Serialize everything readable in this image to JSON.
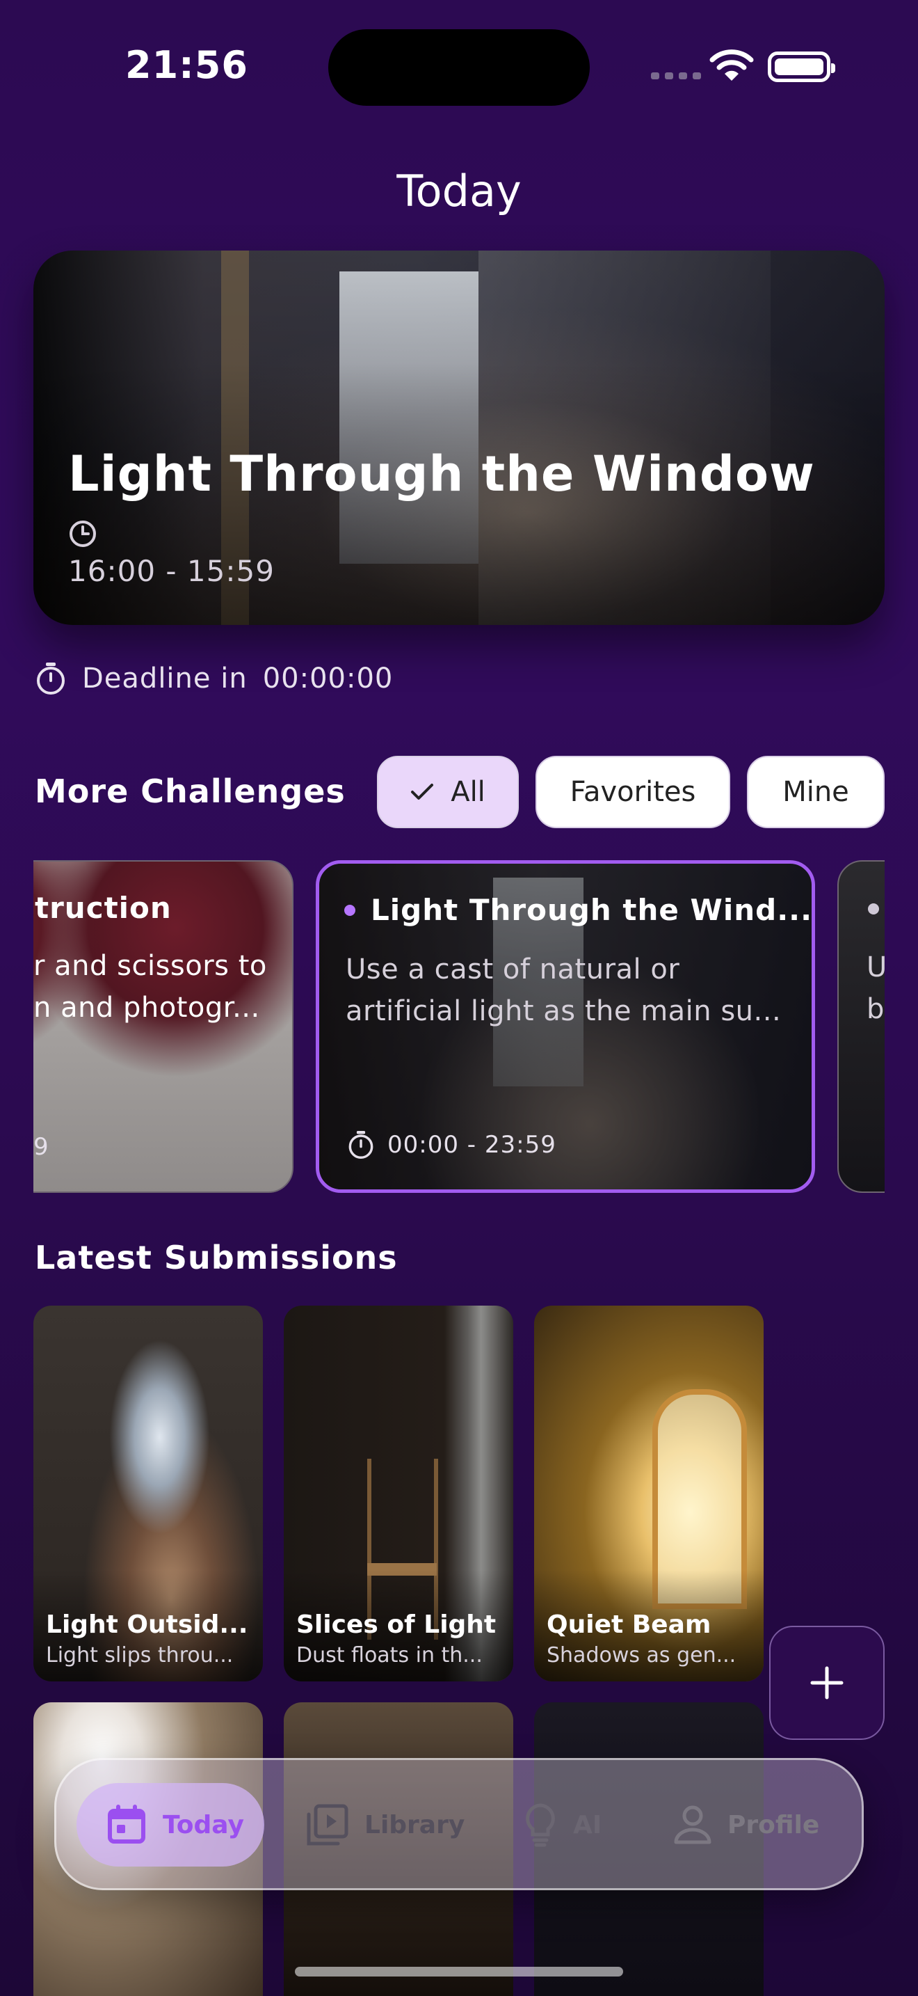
{
  "status_bar": {
    "time": "21:56"
  },
  "header": {
    "title": "Today"
  },
  "hero": {
    "title": "Light Through the Window",
    "time_range": "16:00 - 15:59",
    "clock_icon": "clock-icon"
  },
  "deadline": {
    "label": "Deadline in",
    "countdown": "00:00:00",
    "icon": "stopwatch-icon"
  },
  "more_challenges": {
    "title": "More Challenges",
    "filters": [
      {
        "label": "All",
        "selected": true
      },
      {
        "label": "Favorites",
        "selected": false
      },
      {
        "label": "Mine",
        "selected": false
      }
    ],
    "cards": [
      {
        "title": "truction",
        "desc_lines": [
          "r and scissors to",
          "n and photogr..."
        ],
        "time": "9"
      },
      {
        "title": "Light Through the Wind...",
        "desc_lines": [
          "Use a cast of natural or",
          "artificial light as the main su..."
        ],
        "time": "00:00 - 23:59"
      },
      {
        "title": "",
        "desc_lines": [
          "U",
          "b"
        ],
        "time": ""
      }
    ]
  },
  "latest": {
    "title": "Latest Submissions",
    "items": [
      {
        "title": "Light Outsid...",
        "desc": "Light slips throu..."
      },
      {
        "title": "Slices of Light",
        "desc": "Dust floats in th..."
      },
      {
        "title": "Quiet Beam",
        "desc": "Shadows as gen..."
      }
    ]
  },
  "fab": {
    "icon": "plus-icon"
  },
  "tabbar": {
    "tabs": [
      {
        "label": "Today",
        "icon": "calendar-icon",
        "active": true
      },
      {
        "label": "Library",
        "icon": "play-library-icon",
        "active": false
      },
      {
        "label": "AI",
        "icon": "lightbulb-icon",
        "active": false
      },
      {
        "label": "Profile",
        "icon": "person-icon",
        "active": false
      }
    ]
  },
  "colors": {
    "accent": "#a25cf0",
    "background": "#2c0a52",
    "active_tab_bg": "#d2b4f5"
  }
}
